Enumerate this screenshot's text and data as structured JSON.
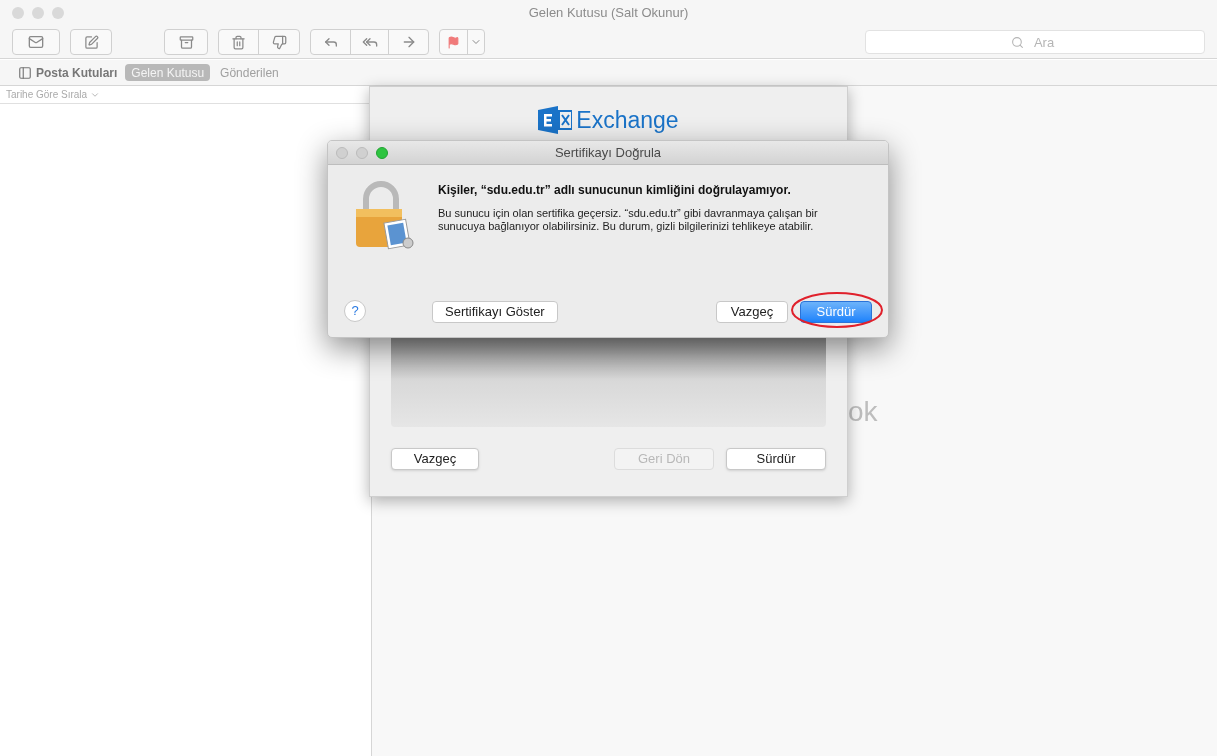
{
  "window": {
    "title": "Gelen Kutusu (Salt Okunur)"
  },
  "search": {
    "placeholder": "Ara"
  },
  "favorites_bar": {
    "mailboxes_button": "Posta Kutuları",
    "tabs": [
      {
        "label": "Gelen Kutusu",
        "selected": true
      },
      {
        "label": "Gönderilen",
        "selected": false
      }
    ]
  },
  "message_list": {
    "sort": "Tarihe Göre Sırala"
  },
  "viewer": {
    "empty_text": "ok"
  },
  "exchange_sheet": {
    "logo_text": "Exchange",
    "buttons": [
      {
        "label": "Vazgeç",
        "disabled": false
      },
      {
        "label": "Geri Dön",
        "disabled": true
      },
      {
        "label": "Sürdür",
        "disabled": false
      }
    ]
  },
  "dialog": {
    "title": "Sertifikayı Doğrula",
    "heading": "Kişiler, “sdu.edu.tr” adlı sunucunun kimliğini doğrulayamıyor.",
    "body": "Bu sunucu için olan sertifika geçersiz. “sdu.edu.tr” gibi davranmaya çalışan bir sunucuya bağlanıyor olabilirsiniz. Bu durum, gizli bilgilerinizi tehlikeye atabilir.",
    "help": "?",
    "buttons": [
      {
        "label": "Sertifikayı Göster",
        "kind": "secondary"
      },
      {
        "label": "Vazgeç",
        "kind": "secondary"
      },
      {
        "label": "Sürdür",
        "kind": "default"
      }
    ]
  }
}
